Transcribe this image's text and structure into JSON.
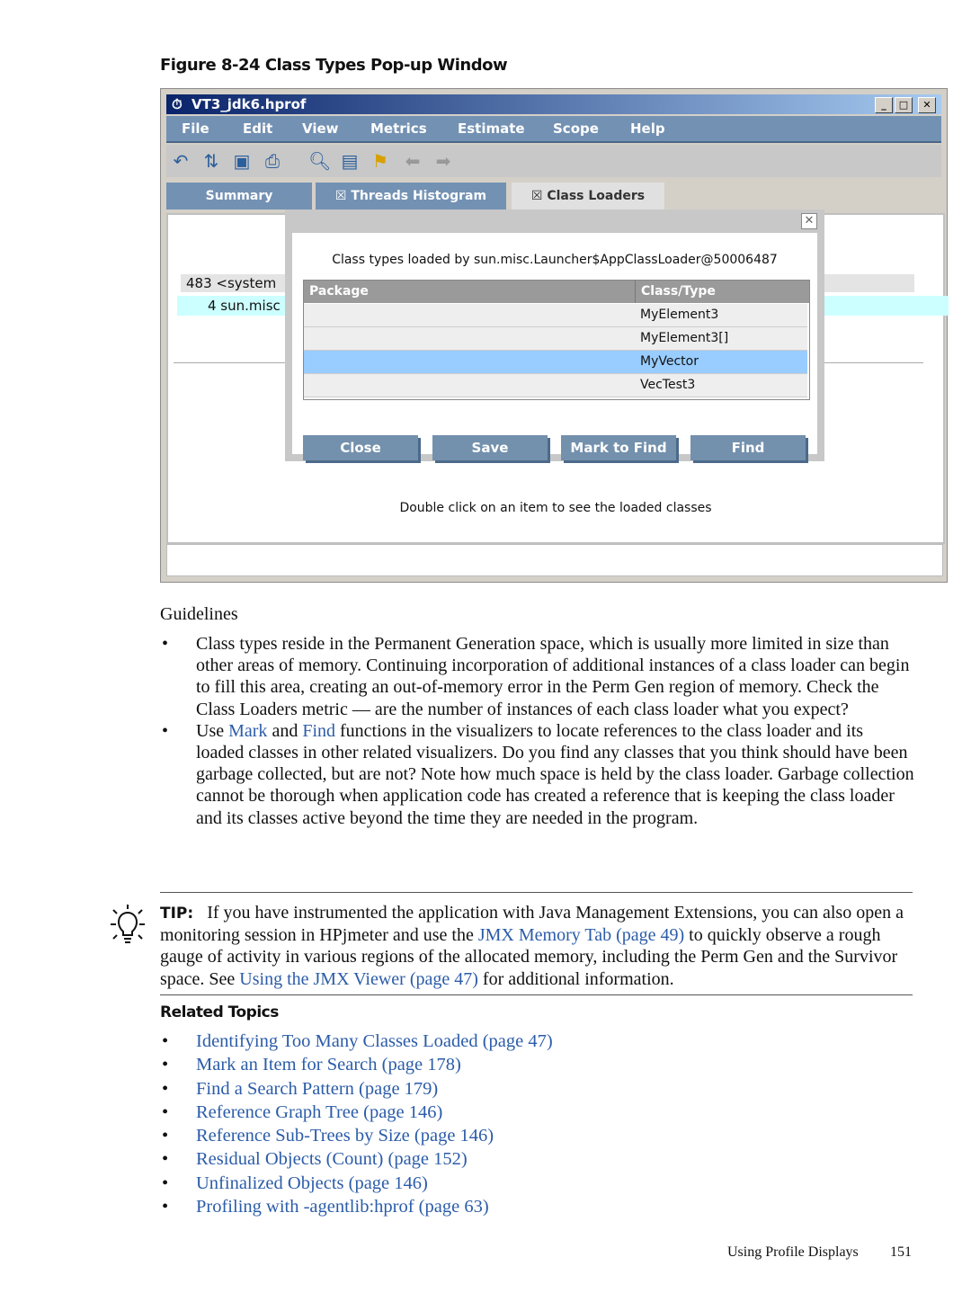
{
  "figure_caption": "Figure 8-24 Class Types Pop-up Window",
  "app": {
    "title": "VT3_jdk6.hprof",
    "menu": [
      "File",
      "Edit",
      "View",
      "Metrics",
      "Estimate",
      "Scope",
      "Help"
    ],
    "toolbar_icons": [
      "undo-icon",
      "compare-icon",
      "save-icon",
      "print-icon",
      "find-icon",
      "document-icon",
      "flag-icon",
      "back-arrow-icon",
      "forward-arrow-icon"
    ],
    "tabs": [
      "Summary",
      "Threads Histogram",
      "Class Loaders"
    ],
    "list": [
      "483 <system",
      "4 sun.misc"
    ],
    "status": "Double click on an item to see the loaded classes",
    "dialog": {
      "heading": "Class types loaded by sun.misc.Launcher$AppClassLoader@50006487",
      "columns": [
        "Package",
        "Class/Type"
      ],
      "rows": [
        "MyElement3",
        "MyElement3[]",
        "MyVector",
        "VecTest3"
      ],
      "selected_row": "MyVector",
      "buttons": [
        "Close",
        "Save",
        "Mark to Find",
        "Find"
      ]
    }
  },
  "guidelines": {
    "heading": "Guidelines",
    "b1": "Class types reside in the Permanent Generation space, which is usually more limited in size than other areas of memory. Continuing incorporation of additional instances of a class loader can begin to fill this area, creating an out-of-memory error in the Perm Gen region of memory. Check the Class Loaders metric — are the number of instances of each class loader what you expect?",
    "b2_pre": "Use ",
    "b2_mark": "Mark",
    "b2_and": " and ",
    "b2_find": "Find",
    "b2_post": " functions in the visualizers to locate references to the class loader and its loaded classes in other related visualizers. Do you find any classes that you think should have been garbage collected, but are not? Note how much space is held by the class loader. Garbage collection cannot be thorough when application code has created a reference that is keeping the class loader and its classes active beyond the time they are needed in the program."
  },
  "tip": {
    "label": "TIP:",
    "t1": "If you have instrumented the application with Java Management Extensions, you can also open a monitoring session in HPjmeter and use the ",
    "link1": "JMX Memory Tab (page 49)",
    "t2": " to quickly observe a rough gauge of activity in various regions of the allocated memory, including the Perm Gen and the Survivor space. See ",
    "link2": "Using the JMX Viewer (page 47)",
    "t3": " for additional information."
  },
  "related": {
    "heading": "Related Topics",
    "links": [
      "Identifying Too Many Classes Loaded (page 47)",
      "Mark an Item for Search (page 178)",
      "Find a Search Pattern (page 179)",
      "Reference Graph Tree (page 146)",
      "Reference Sub-Trees by Size (page 146)",
      "Residual Objects (Count) (page 152)",
      "Unfinalized Objects (page 146)",
      "Profiling with -agentlib:hprof (page 63)"
    ]
  },
  "footer": {
    "section": "Using Profile Displays",
    "page": "151"
  },
  "colors": {
    "link": "#2b5ca8",
    "menu": "#7391b3",
    "selected_row": "#99ccff"
  }
}
